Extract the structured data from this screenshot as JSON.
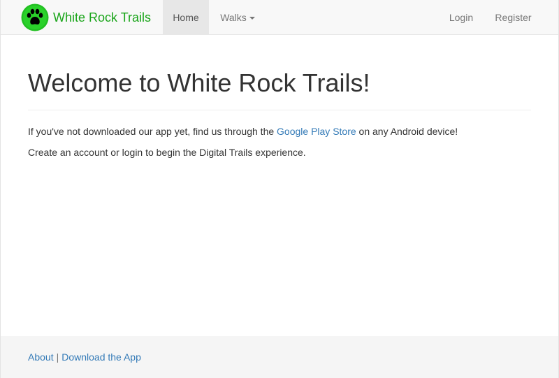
{
  "navbar": {
    "brand": {
      "logo_icon": "paw-print-icon",
      "title": "White Rock Trails"
    },
    "items": {
      "home": "Home",
      "walks": "Walks",
      "login": "Login",
      "register": "Register"
    }
  },
  "main": {
    "heading": "Welcome to White Rock Trails!",
    "paragraph1": {
      "before": "If you've not downloaded our app yet, find us through the ",
      "link": "Google Play Store",
      "after": " on any Android device!"
    },
    "paragraph2": "Create an account or login to begin the Digital Trails experience."
  },
  "footer": {
    "about": "About",
    "separator": "|",
    "download": "Download the App"
  },
  "colors": {
    "brand_green": "#1aa51a",
    "link_blue": "#337ab7",
    "navbar_bg": "#f8f8f8",
    "footer_bg": "#f5f5f5"
  }
}
